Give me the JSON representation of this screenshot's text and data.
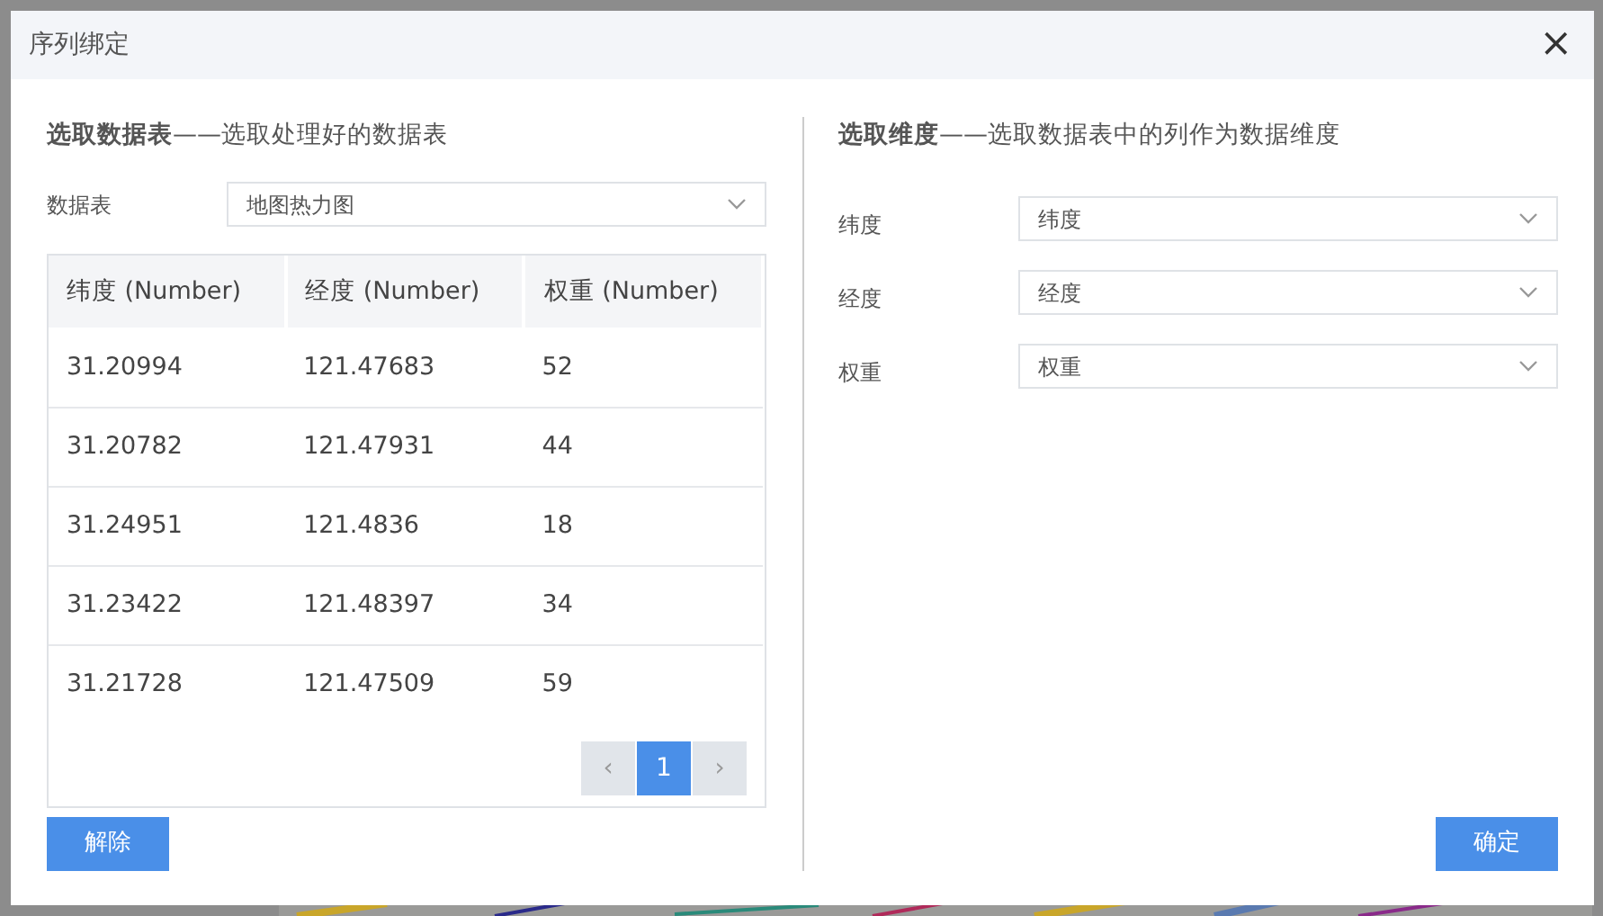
{
  "dialog": {
    "title": "序列绑定",
    "close": "×"
  },
  "left": {
    "heading_bold": "选取数据表",
    "heading_rest": "——选取处理好的数据表",
    "table_label": "数据表",
    "table_select": "地图热力图",
    "table": {
      "columns": [
        "纬度 (Number)",
        "经度 (Number)",
        "权重 (Number)"
      ],
      "rows": [
        [
          "31.20994",
          "121.47683",
          "52"
        ],
        [
          "31.20782",
          "121.47931",
          "44"
        ],
        [
          "31.24951",
          "121.4836",
          "18"
        ],
        [
          "31.23422",
          "121.48397",
          "34"
        ],
        [
          "31.21728",
          "121.47509",
          "59"
        ]
      ]
    },
    "pagination": {
      "prev": "‹",
      "pages": [
        {
          "label": "1",
          "selected": true
        }
      ],
      "next": "›"
    },
    "button": "解除"
  },
  "right": {
    "heading_bold": "选取维度",
    "heading_rest": "——选取数据表中的列作为数据维度",
    "fields": [
      {
        "label": "纬度",
        "value": "纬度"
      },
      {
        "label": "经度",
        "value": "经度"
      },
      {
        "label": "权重",
        "value": "权重"
      }
    ],
    "button": "确定"
  }
}
